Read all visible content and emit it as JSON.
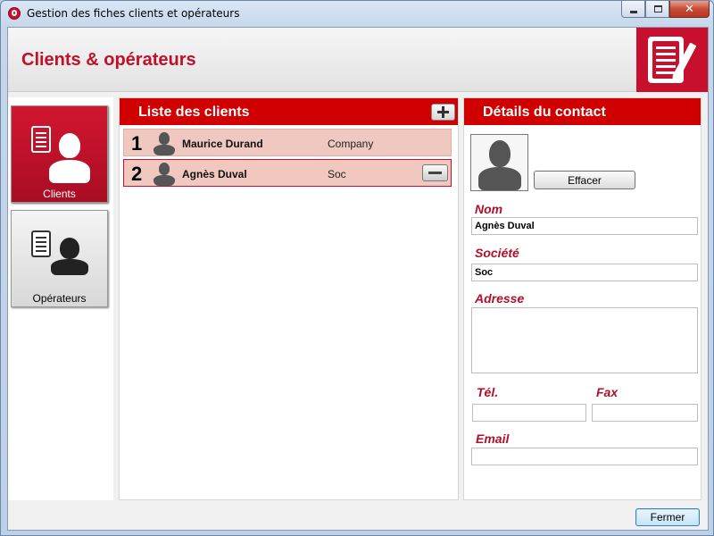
{
  "window": {
    "title": "Gestion des fiches clients et opérateurs",
    "controls": {
      "minimize": "minimize-icon",
      "maximize": "maximize-icon",
      "close": "✕"
    }
  },
  "header": {
    "title": "Clients & opérateurs",
    "logo_icon": "document-pencil-icon"
  },
  "nav": {
    "items": [
      {
        "label": "Clients",
        "icon": "client-person-icon",
        "active": true
      },
      {
        "label": "Opérateurs",
        "icon": "operator-person-icon",
        "active": false
      }
    ]
  },
  "client_list": {
    "title": "Liste des clients",
    "add_icon": "plus-icon",
    "rows": [
      {
        "num": "1",
        "name": "Maurice Durand",
        "company": "Company",
        "selected": false
      },
      {
        "num": "2",
        "name": "Agnès Duval",
        "company": "Soc",
        "selected": true
      }
    ],
    "remove_icon": "minus-icon"
  },
  "details": {
    "title": "Détails du contact",
    "clear_label": "Effacer",
    "name_label": "Nom",
    "name_value": "Agnès Duval",
    "company_label": "Société",
    "company_value": "Soc",
    "address_label": "Adresse",
    "address_value": "",
    "phone_label": "Tél.",
    "phone_value": "",
    "fax_label": "Fax",
    "fax_value": "",
    "email_label": "Email",
    "email_value": ""
  },
  "footer": {
    "close_label": "Fermer"
  },
  "colors": {
    "accent": "#c8102e",
    "panel_header": "#d00000",
    "row_bg": "#f0c8c0"
  }
}
